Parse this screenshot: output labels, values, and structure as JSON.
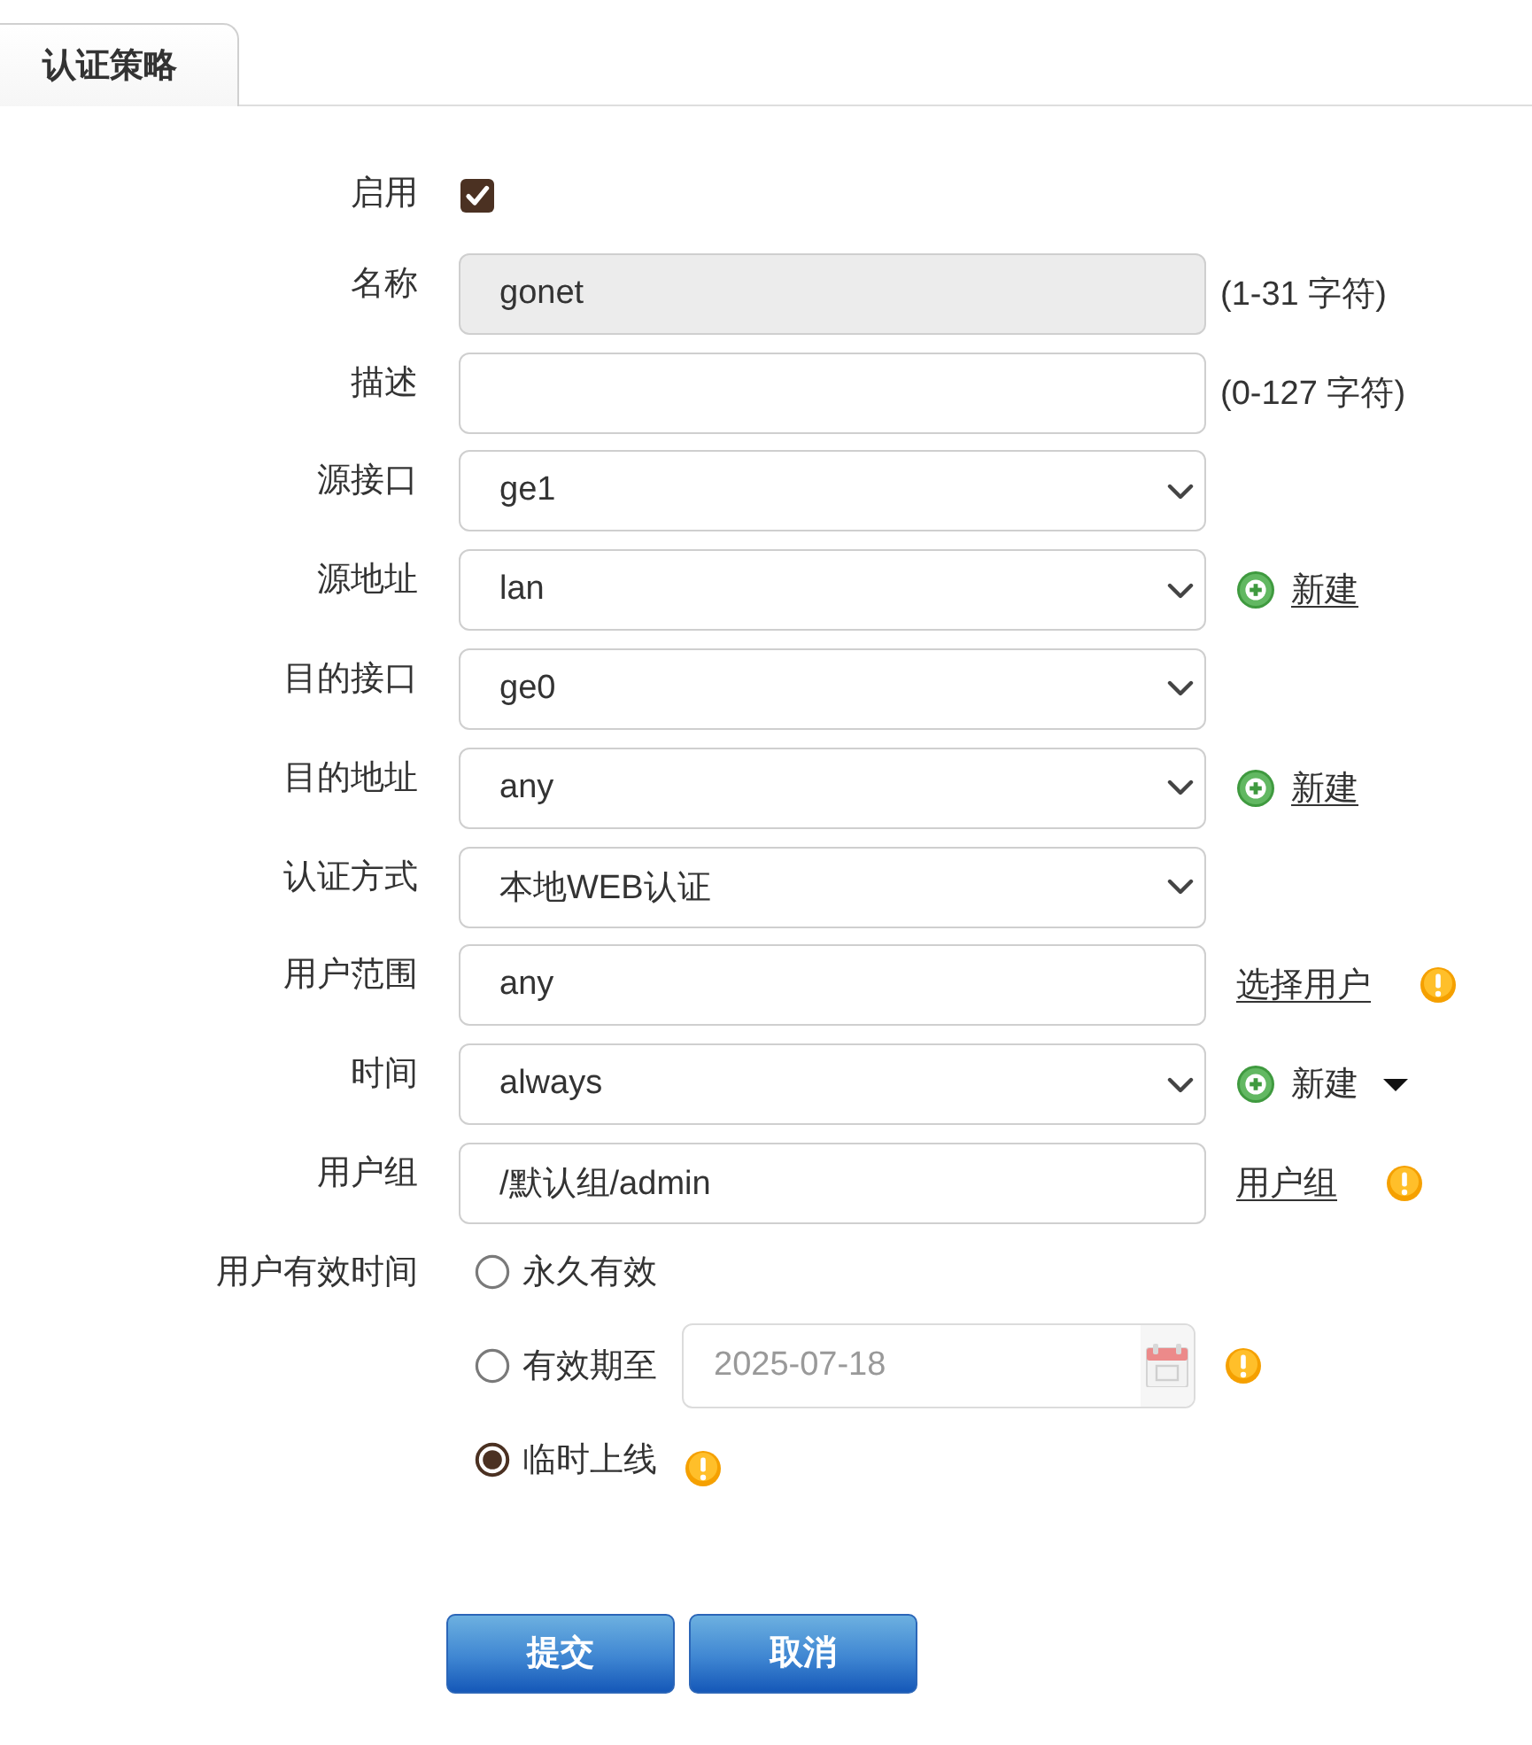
{
  "tabs": [
    {
      "label": "认证策略",
      "selected": true
    }
  ],
  "form": {
    "rows": [
      {
        "kind": "checkbox",
        "label": "启用",
        "checked": true
      },
      {
        "kind": "text",
        "label": "名称",
        "value": "gonet",
        "disabled": true,
        "hint": "(1-31 字符)"
      },
      {
        "kind": "text",
        "label": "描述",
        "disabled": false,
        "hint": "(0-127 字符)"
      },
      {
        "kind": "select",
        "label": "源接口",
        "value": "ge1"
      },
      {
        "kind": "select",
        "label": "源地址",
        "value": "lan",
        "action": {
          "kind": "new",
          "label": "新建"
        }
      },
      {
        "kind": "select",
        "label": "目的接口",
        "value": "ge0"
      },
      {
        "kind": "select",
        "label": "目的地址",
        "value": "any",
        "action": {
          "kind": "new",
          "label": "新建"
        }
      },
      {
        "kind": "select",
        "label": "认证方式",
        "value": "本地WEB认证"
      },
      {
        "kind": "text",
        "label": "用户范围",
        "value": "any",
        "disabled": false,
        "action": {
          "kind": "link",
          "label": "选择用户"
        },
        "info": true
      },
      {
        "kind": "select",
        "label": "时间",
        "value": "always",
        "action": {
          "kind": "new-menu",
          "label": "新建"
        }
      },
      {
        "kind": "text",
        "label": "用户组",
        "value": "/默认组/admin",
        "disabled": false,
        "action": {
          "kind": "link",
          "label": "用户组"
        },
        "info": true
      },
      {
        "kind": "radio",
        "label": "用户有效时间",
        "options": [
          {
            "label": "永久有效",
            "selected": false
          },
          {
            "label": "有效期至",
            "selected": false,
            "date": {
              "value": "2025-07-18",
              "disabled": true
            },
            "info": true
          },
          {
            "label": "临时上线",
            "selected": true,
            "info": true
          }
        ]
      }
    ]
  },
  "buttons": [
    {
      "label": "提交"
    },
    {
      "label": "取消"
    }
  ]
}
